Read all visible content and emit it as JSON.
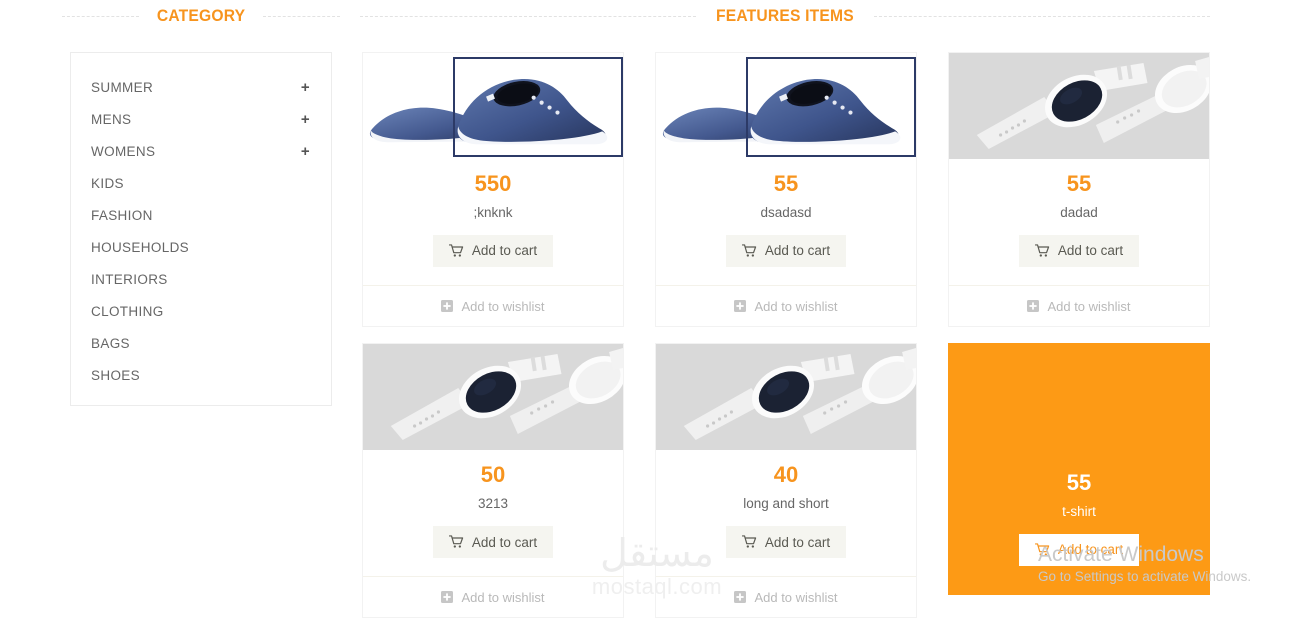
{
  "sidebar": {
    "heading": "CATEGORY",
    "items": [
      {
        "label": "SUMMER",
        "expander": "+"
      },
      {
        "label": "MENS",
        "expander": "+"
      },
      {
        "label": "WOMENS",
        "expander": "+"
      },
      {
        "label": "KIDS",
        "expander": ""
      },
      {
        "label": "FASHION",
        "expander": ""
      },
      {
        "label": "HOUSEHOLDS",
        "expander": ""
      },
      {
        "label": "INTERIORS",
        "expander": ""
      },
      {
        "label": "CLOTHING",
        "expander": ""
      },
      {
        "label": "BAGS",
        "expander": ""
      },
      {
        "label": "SHOES",
        "expander": ""
      }
    ]
  },
  "features": {
    "heading": "FEATURES ITEMS",
    "add_to_cart_label": "Add to cart",
    "add_to_wishlist_label": "Add to wishlist",
    "cart_icon": "shopping-cart-icon",
    "wishlist_icon": "plus-square-icon",
    "accent_color": "#F7941E",
    "highlight_color": "#FD9A15",
    "products": [
      {
        "price": "550",
        "name": ";knknk",
        "image": "blue-sneakers-photo",
        "highlighted": false
      },
      {
        "price": "55",
        "name": "dsadasd",
        "image": "blue-sneakers-photo",
        "highlighted": false
      },
      {
        "price": "55",
        "name": "dadad",
        "image": "white-smartwatch-photo",
        "highlighted": false
      },
      {
        "price": "50",
        "name": "3213",
        "image": "white-smartwatch-photo",
        "highlighted": false
      },
      {
        "price": "40",
        "name": "long and short",
        "image": "white-smartwatch-photo",
        "highlighted": false
      },
      {
        "price": "55",
        "name": "t-shirt",
        "image": "none",
        "highlighted": true
      }
    ]
  },
  "watermarks": {
    "mostaql_arabic": "مستقل",
    "mostaql_latin": "mostaql.com",
    "windows_line1": "Activate Windows",
    "windows_line2": "Go to Settings to activate Windows."
  }
}
